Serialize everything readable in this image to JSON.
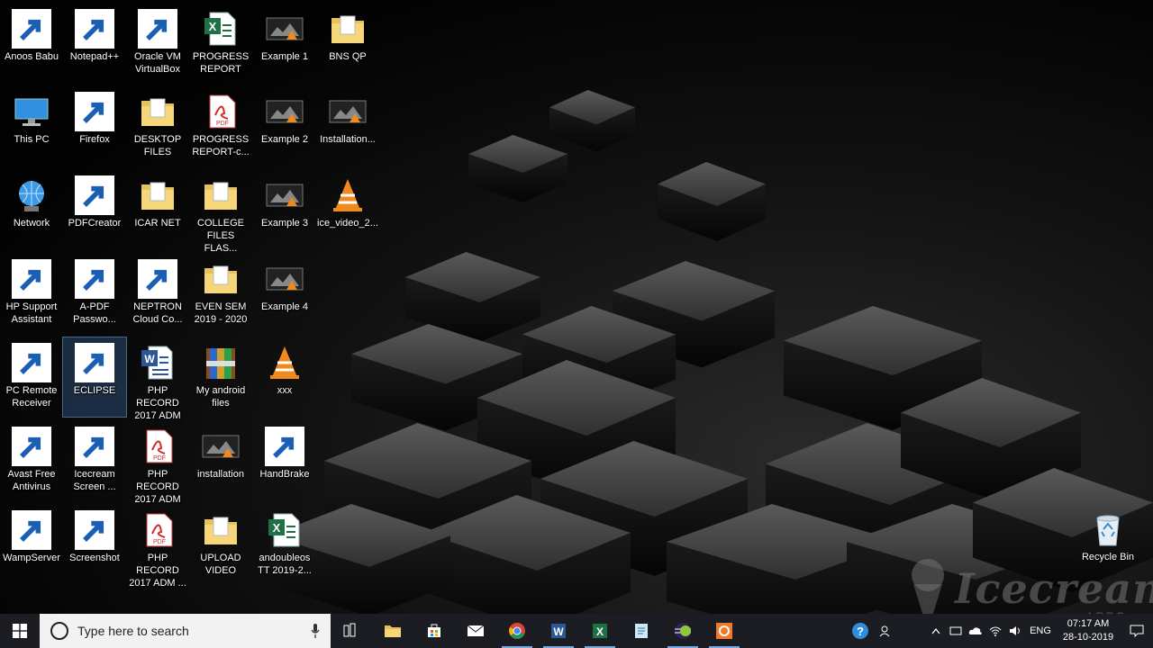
{
  "desktop": {
    "icons": [
      {
        "label": "Anoos Babu",
        "icon": "user-folder-icon"
      },
      {
        "label": "Notepad++",
        "icon": "notepad-plus-icon"
      },
      {
        "label": "Oracle VM VirtualBox",
        "icon": "virtualbox-icon"
      },
      {
        "label": "PROGRESS REPORT",
        "icon": "excel-file-icon"
      },
      {
        "label": "Example 1",
        "icon": "video-file-icon"
      },
      {
        "label": "BNS QP",
        "icon": "folder-icon"
      },
      {
        "label": "This PC",
        "icon": "computer-icon"
      },
      {
        "label": "Firefox",
        "icon": "firefox-icon"
      },
      {
        "label": "DESKTOP FILES",
        "icon": "folder-icon"
      },
      {
        "label": "PROGRESS REPORT-c...",
        "icon": "pdf-file-icon"
      },
      {
        "label": "Example 2",
        "icon": "video-file-icon"
      },
      {
        "label": "Installation...",
        "icon": "video-file-icon"
      },
      {
        "label": "Network",
        "icon": "network-icon"
      },
      {
        "label": "PDFCreator",
        "icon": "pdfcreator-icon"
      },
      {
        "label": "ICAR NET",
        "icon": "folder-icon"
      },
      {
        "label": "COLLEGE FILES FLAS...",
        "icon": "folder-icon"
      },
      {
        "label": "Example 3",
        "icon": "video-file-icon"
      },
      {
        "label": "ice_video_2...",
        "icon": "vlc-icon"
      },
      {
        "label": "HP Support Assistant",
        "icon": "help-icon"
      },
      {
        "label": "A-PDF Passwo...",
        "icon": "apdf-icon"
      },
      {
        "label": "NEPTRON Cloud Co...",
        "icon": "neptron-icon"
      },
      {
        "label": "EVEN SEM 2019 - 2020",
        "icon": "folder-icon"
      },
      {
        "label": "Example 4",
        "icon": "video-file-icon"
      },
      {
        "label": "PC Remote Receiver",
        "icon": "remote-icon"
      },
      {
        "label": "ECLIPSE",
        "icon": "eclipse-icon"
      },
      {
        "label": "PHP RECORD 2017 ADM",
        "icon": "word-file-icon"
      },
      {
        "label": "My android files",
        "icon": "archive-icon"
      },
      {
        "label": "xxx",
        "icon": "vlc-icon"
      },
      {
        "label": "Avast Free Antivirus",
        "icon": "avast-icon"
      },
      {
        "label": "Icecream Screen ...",
        "icon": "icecream-icon"
      },
      {
        "label": "PHP RECORD 2017 ADM",
        "icon": "pdf-file-icon"
      },
      {
        "label": "installation",
        "icon": "video-file-icon"
      },
      {
        "label": "HandBrake",
        "icon": "handbrake-icon"
      },
      {
        "label": "WampServer",
        "icon": "wamp-icon"
      },
      {
        "label": "Screenshot",
        "icon": "screenshot-icon"
      },
      {
        "label": "PHP RECORD 2017 ADM ...",
        "icon": "pdf-file-icon"
      },
      {
        "label": "UPLOAD VIDEO",
        "icon": "folder-icon"
      },
      {
        "label": "andoubleos TT 2019-2...",
        "icon": "excel-file-icon"
      }
    ],
    "recycle_bin": {
      "label": "Recycle Bin",
      "icon": "recycle-bin-icon"
    }
  },
  "watermark": {
    "brand": "Icecream",
    "sub": "APPS"
  },
  "taskbar": {
    "search_placeholder": "Type here to search",
    "apps": [
      {
        "name": "task-view",
        "icon": "task-view-icon"
      },
      {
        "name": "file-explorer",
        "icon": "folder-icon"
      },
      {
        "name": "store",
        "icon": "store-icon"
      },
      {
        "name": "mail",
        "icon": "mail-icon"
      },
      {
        "name": "chrome",
        "icon": "chrome-icon"
      },
      {
        "name": "word",
        "icon": "word-icon"
      },
      {
        "name": "excel",
        "icon": "excel-icon"
      },
      {
        "name": "notepad",
        "icon": "notepad-icon"
      },
      {
        "name": "eclipse",
        "icon": "eclipse-icon"
      },
      {
        "name": "icecream",
        "icon": "icecream-icon"
      }
    ],
    "tray": {
      "language": "ENG",
      "time": "07:17 AM",
      "date": "28-10-2019"
    }
  },
  "colors": {
    "taskbar": "#1b1d22",
    "accent": "#7aa8e0",
    "selection": "#508cdc"
  }
}
